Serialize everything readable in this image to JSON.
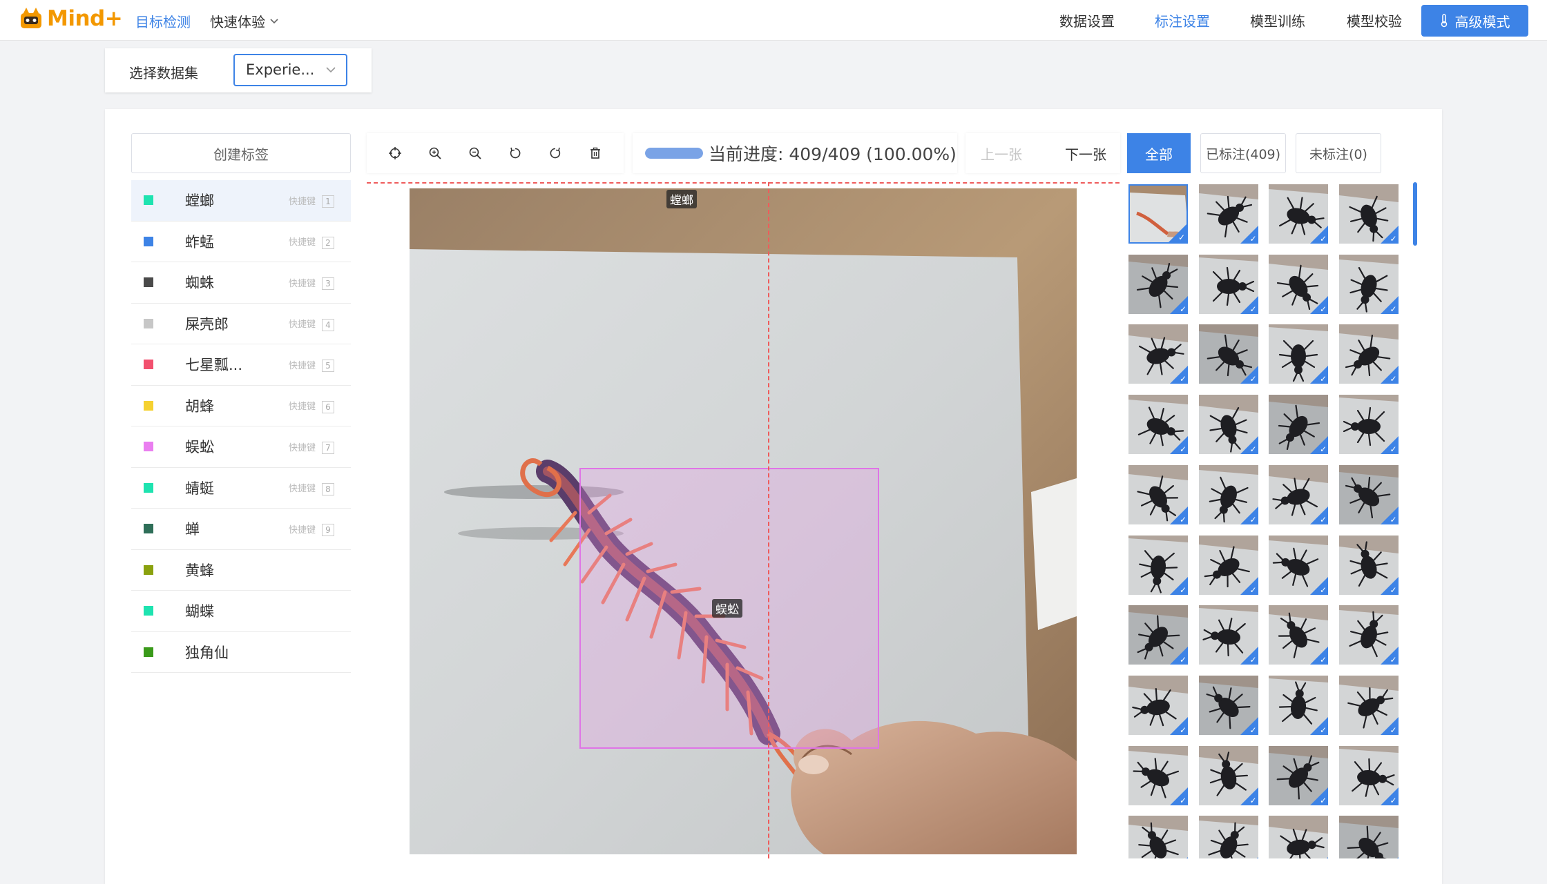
{
  "app": {
    "logo_text": "Mind+",
    "nav_left": [
      {
        "label": "目标检测",
        "active": true
      },
      {
        "label": "快速体验",
        "dropdown": true
      }
    ],
    "nav_right": [
      {
        "label": "数据设置",
        "active": false
      },
      {
        "label": "标注设置",
        "active": true
      },
      {
        "label": "模型训练",
        "active": false
      },
      {
        "label": "模型校验",
        "active": false
      }
    ],
    "advanced_button": "高级模式",
    "accent_color": "#3d83e6"
  },
  "dataset": {
    "label": "选择数据集",
    "selected": "Experie..."
  },
  "labels_panel": {
    "create_button": "创建标签",
    "shortcut_text": "快捷键",
    "items": [
      {
        "name": "螳螂",
        "color": "#1ee3b0",
        "key": "1",
        "selected": true
      },
      {
        "name": "蚱蜢",
        "color": "#3d83e6",
        "key": "2"
      },
      {
        "name": "蜘蛛",
        "color": "#4a4a4a",
        "key": "3"
      },
      {
        "name": "屎壳郎",
        "color": "#c7c7c7",
        "key": "4"
      },
      {
        "name": "七星瓢...",
        "color": "#f2506e",
        "key": "5"
      },
      {
        "name": "胡蜂",
        "color": "#f5d130",
        "key": "6"
      },
      {
        "name": "蜈蚣",
        "color": "#ea7ef0",
        "key": "7"
      },
      {
        "name": "蜻蜓",
        "color": "#1ee3b0",
        "key": "8"
      },
      {
        "name": "蝉",
        "color": "#2e6e58",
        "key": "9"
      },
      {
        "name": "黄蜂",
        "color": "#8aa10e",
        "key": ""
      },
      {
        "name": "蝴蝶",
        "color": "#1ee3b0",
        "key": ""
      },
      {
        "name": "独角仙",
        "color": "#3a9a1a",
        "key": ""
      }
    ]
  },
  "toolbar": {
    "tools": [
      "crosshair-icon",
      "zoom-in-icon",
      "zoom-out-icon",
      "rotate-left-icon",
      "rotate-right-icon",
      "delete-icon"
    ]
  },
  "progress": {
    "text": "当前进度: 409/409 (100.00%)",
    "fraction": 1.0
  },
  "navigation": {
    "prev": "上一张",
    "next": "下一张"
  },
  "filters": {
    "all": "全部",
    "labeled": "已标注(409)",
    "unlabeled": "未标注(0)"
  },
  "canvas": {
    "crosshair_label": "螳螂",
    "box_label": "蜈蚣"
  },
  "thumbnails": {
    "rows": 10,
    "cols": 4
  }
}
